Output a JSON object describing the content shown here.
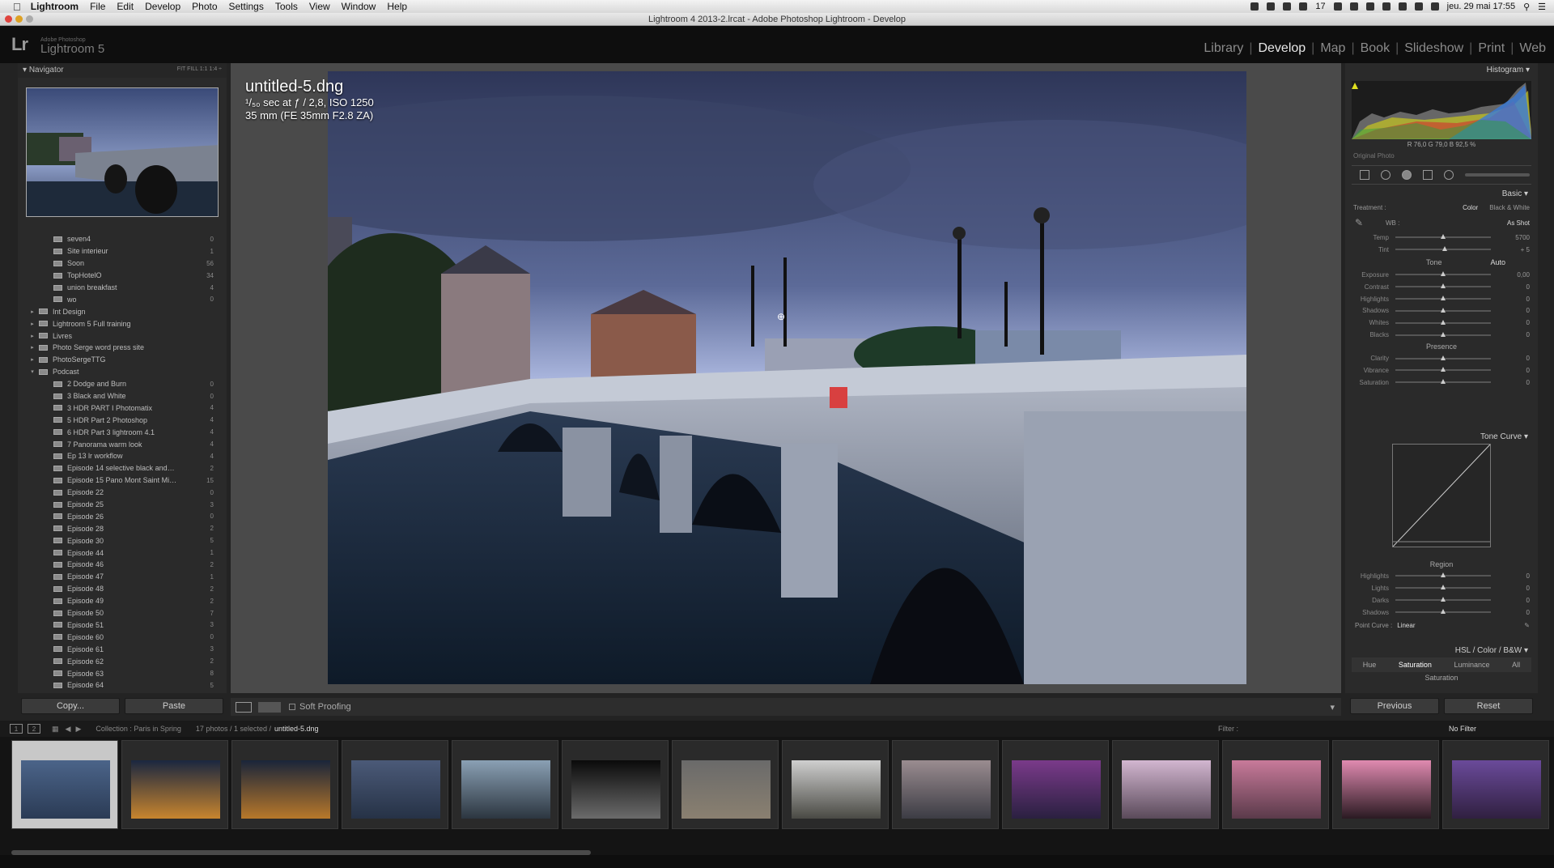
{
  "menubar": {
    "app": "Lightroom",
    "items": [
      "File",
      "Edit",
      "Develop",
      "Photo",
      "Settings",
      "Tools",
      "View",
      "Window",
      "Help"
    ],
    "status_number": "17",
    "clock": "jeu. 29 mai  17:55"
  },
  "window": {
    "title": "Lightroom 4 2013-2.lrcat - Adobe Photoshop Lightroom - Develop"
  },
  "branding": {
    "logo": "Lr",
    "sub": "Adobe Photoshop",
    "name": "Lightroom 5"
  },
  "modules": [
    "Library",
    "Develop",
    "Map",
    "Book",
    "Slideshow",
    "Print",
    "Web"
  ],
  "active_module": "Develop",
  "navigator": {
    "title": "Navigator",
    "options": "FIT  FILL  1:1  1:4 ÷"
  },
  "folders": [
    {
      "name": "seven4",
      "count": "0",
      "level": 2
    },
    {
      "name": "Site interieur",
      "count": "1",
      "level": 2
    },
    {
      "name": "Soon",
      "count": "56",
      "level": 2
    },
    {
      "name": "TopHotelO",
      "count": "34",
      "level": 2
    },
    {
      "name": "union breakfast",
      "count": "4",
      "level": 2
    },
    {
      "name": "wo",
      "count": "0",
      "level": 2
    },
    {
      "name": "Int Design",
      "count": "",
      "level": 1,
      "tri": "▸"
    },
    {
      "name": "Lightroom 5 Full training",
      "count": "",
      "level": 1,
      "tri": "▸"
    },
    {
      "name": "Livres",
      "count": "",
      "level": 1,
      "tri": "▸"
    },
    {
      "name": "Photo Serge word press site",
      "count": "",
      "level": 1,
      "tri": "▸"
    },
    {
      "name": "PhotoSergeTTG",
      "count": "",
      "level": 1,
      "tri": "▸"
    },
    {
      "name": "Podcast",
      "count": "",
      "level": 1,
      "tri": "▾"
    },
    {
      "name": "2 Dodge and Burn",
      "count": "0",
      "level": 2
    },
    {
      "name": "3 Black and White",
      "count": "0",
      "level": 2
    },
    {
      "name": "3 HDR PART I Photomatix",
      "count": "4",
      "level": 2
    },
    {
      "name": "5 HDR Part 2 Photoshop",
      "count": "4",
      "level": 2
    },
    {
      "name": "6 HDR Part 3 lightroom 4.1",
      "count": "4",
      "level": 2
    },
    {
      "name": "7 Panorama warm look",
      "count": "4",
      "level": 2
    },
    {
      "name": "Ep 13 lr workflow",
      "count": "4",
      "level": 2
    },
    {
      "name": "Episode 14 selective black and…",
      "count": "2",
      "level": 2
    },
    {
      "name": "Episode 15 Pano Mont Saint Mi…",
      "count": "15",
      "level": 2
    },
    {
      "name": "Episode 22",
      "count": "0",
      "level": 2
    },
    {
      "name": "Episode 25",
      "count": "3",
      "level": 2
    },
    {
      "name": "Episode 26",
      "count": "0",
      "level": 2
    },
    {
      "name": "Episode 28",
      "count": "2",
      "level": 2
    },
    {
      "name": "Episode 30",
      "count": "5",
      "level": 2
    },
    {
      "name": "Episode 44",
      "count": "1",
      "level": 2
    },
    {
      "name": "Episode 46",
      "count": "2",
      "level": 2
    },
    {
      "name": "Episode 47",
      "count": "1",
      "level": 2
    },
    {
      "name": "Episode 48",
      "count": "2",
      "level": 2
    },
    {
      "name": "Episode 49",
      "count": "2",
      "level": 2
    },
    {
      "name": "Episode 50",
      "count": "7",
      "level": 2
    },
    {
      "name": "Episode 51",
      "count": "3",
      "level": 2
    },
    {
      "name": "Episode 60",
      "count": "0",
      "level": 2
    },
    {
      "name": "Episode 61",
      "count": "3",
      "level": 2
    },
    {
      "name": "Episode 62",
      "count": "2",
      "level": 2
    },
    {
      "name": "Episode 63",
      "count": "8",
      "level": 2
    },
    {
      "name": "Episode 64",
      "count": "5",
      "level": 2
    }
  ],
  "left_buttons": {
    "copy": "Copy...",
    "paste": "Paste"
  },
  "photo_info": {
    "filename": "untitled-5.dng",
    "exposure": "¹/₅₀ sec at ƒ / 2,8, ISO 1250",
    "lens": "35 mm (FE 35mm F2.8 ZA)"
  },
  "toolbar": {
    "soft_proofing": "Soft Proofing"
  },
  "histogram": {
    "title": "Histogram",
    "values": "R 76,0  G 79,0  B 92,5 %",
    "original_photo": "Original Photo"
  },
  "basic": {
    "title": "Basic",
    "treatment_label": "Treatment :",
    "treatment_color": "Color",
    "treatment_bw": "Black & White",
    "wb_label": "WB :",
    "wb_value": "As Shot",
    "tone_label": "Tone",
    "auto": "Auto",
    "presence_label": "Presence",
    "sliders_wb": [
      {
        "label": "Temp",
        "value": "5700",
        "pos": 0.5
      },
      {
        "label": "Tint",
        "value": "+ 5",
        "pos": 0.52
      }
    ],
    "sliders_tone": [
      {
        "label": "Exposure",
        "value": "0,00",
        "pos": 0.5
      },
      {
        "label": "Contrast",
        "value": "0",
        "pos": 0.5
      },
      {
        "label": "Highlights",
        "value": "0",
        "pos": 0.5
      },
      {
        "label": "Shadows",
        "value": "0",
        "pos": 0.5
      },
      {
        "label": "Whites",
        "value": "0",
        "pos": 0.5
      },
      {
        "label": "Blacks",
        "value": "0",
        "pos": 0.5
      }
    ],
    "sliders_presence": [
      {
        "label": "Clarity",
        "value": "0",
        "pos": 0.5
      },
      {
        "label": "Vibrance",
        "value": "0",
        "pos": 0.5
      },
      {
        "label": "Saturation",
        "value": "0",
        "pos": 0.5
      }
    ]
  },
  "tone_curve": {
    "title": "Tone Curve",
    "region": "Region",
    "sliders": [
      {
        "label": "Highlights",
        "value": "0",
        "pos": 0.5
      },
      {
        "label": "Lights",
        "value": "0",
        "pos": 0.5
      },
      {
        "label": "Darks",
        "value": "0",
        "pos": 0.5
      },
      {
        "label": "Shadows",
        "value": "0",
        "pos": 0.5
      }
    ],
    "point_curve_label": "Point Curve :",
    "point_curve_value": "Linear"
  },
  "hsl": {
    "title": "HSL  /  Color  /  B&W",
    "tabs": [
      "Hue",
      "Saturation",
      "Luminance",
      "All"
    ],
    "selected": "Saturation",
    "sub": "Saturation"
  },
  "right_buttons": {
    "previous": "Previous",
    "reset": "Reset"
  },
  "filmstrip": {
    "collection_label": "Collection : Paris in Spring",
    "count": "17 photos / 1 selected /",
    "current": "untitled-5.dng",
    "filter_label": "Filter :",
    "filter_value": "No Filter",
    "page1": "1",
    "page2": "2",
    "thumbs": [
      {
        "top": "#4b6489",
        "bot": "#2b3b55"
      },
      {
        "top": "#1b2740",
        "bot": "#c8852e"
      },
      {
        "top": "#1a253a",
        "bot": "#b8782a"
      },
      {
        "top": "#4b5a78",
        "bot": "#263246"
      },
      {
        "top": "#8aa0b4",
        "bot": "#2c3640"
      },
      {
        "top": "#0a0a0a",
        "bot": "#6b6b6b"
      },
      {
        "top": "#6a6a6a",
        "bot": "#8a8070"
      },
      {
        "top": "#cfcfcf",
        "bot": "#4a4a44"
      },
      {
        "top": "#9a8c90",
        "bot": "#3c3c44"
      },
      {
        "top": "#7a3a8a",
        "bot": "#2a2040"
      },
      {
        "top": "#d2b6d0",
        "bot": "#5a4a5a"
      },
      {
        "top": "#c87a9a",
        "bot": "#5a3a4a"
      },
      {
        "top": "#e08ab0",
        "bot": "#2a1a22"
      },
      {
        "top": "#6a4a9a",
        "bot": "#302040"
      }
    ]
  }
}
